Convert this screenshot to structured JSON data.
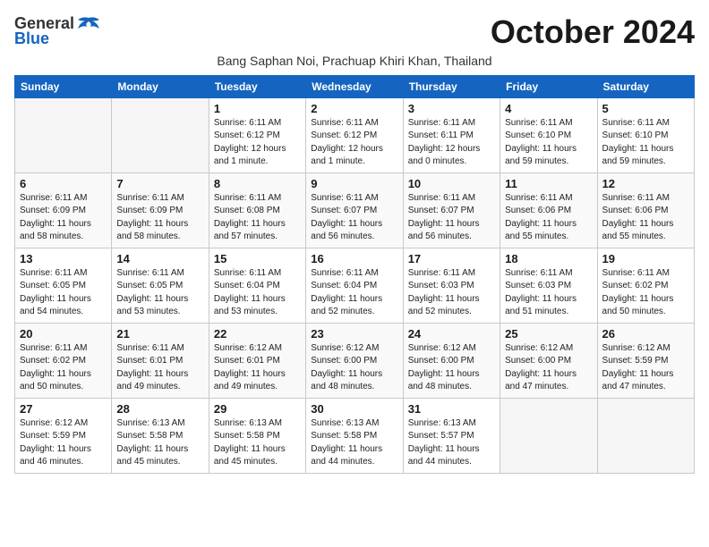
{
  "logo": {
    "general": "General",
    "blue": "Blue"
  },
  "title": "October 2024",
  "subtitle": "Bang Saphan Noi, Prachuap Khiri Khan, Thailand",
  "days_of_week": [
    "Sunday",
    "Monday",
    "Tuesday",
    "Wednesday",
    "Thursday",
    "Friday",
    "Saturday"
  ],
  "weeks": [
    [
      {
        "day": "",
        "empty": true
      },
      {
        "day": "",
        "empty": true
      },
      {
        "day": "1",
        "sunrise": "Sunrise: 6:11 AM",
        "sunset": "Sunset: 6:12 PM",
        "daylight": "Daylight: 12 hours and 1 minute."
      },
      {
        "day": "2",
        "sunrise": "Sunrise: 6:11 AM",
        "sunset": "Sunset: 6:12 PM",
        "daylight": "Daylight: 12 hours and 1 minute."
      },
      {
        "day": "3",
        "sunrise": "Sunrise: 6:11 AM",
        "sunset": "Sunset: 6:11 PM",
        "daylight": "Daylight: 12 hours and 0 minutes."
      },
      {
        "day": "4",
        "sunrise": "Sunrise: 6:11 AM",
        "sunset": "Sunset: 6:10 PM",
        "daylight": "Daylight: 11 hours and 59 minutes."
      },
      {
        "day": "5",
        "sunrise": "Sunrise: 6:11 AM",
        "sunset": "Sunset: 6:10 PM",
        "daylight": "Daylight: 11 hours and 59 minutes."
      }
    ],
    [
      {
        "day": "6",
        "sunrise": "Sunrise: 6:11 AM",
        "sunset": "Sunset: 6:09 PM",
        "daylight": "Daylight: 11 hours and 58 minutes."
      },
      {
        "day": "7",
        "sunrise": "Sunrise: 6:11 AM",
        "sunset": "Sunset: 6:09 PM",
        "daylight": "Daylight: 11 hours and 58 minutes."
      },
      {
        "day": "8",
        "sunrise": "Sunrise: 6:11 AM",
        "sunset": "Sunset: 6:08 PM",
        "daylight": "Daylight: 11 hours and 57 minutes."
      },
      {
        "day": "9",
        "sunrise": "Sunrise: 6:11 AM",
        "sunset": "Sunset: 6:07 PM",
        "daylight": "Daylight: 11 hours and 56 minutes."
      },
      {
        "day": "10",
        "sunrise": "Sunrise: 6:11 AM",
        "sunset": "Sunset: 6:07 PM",
        "daylight": "Daylight: 11 hours and 56 minutes."
      },
      {
        "day": "11",
        "sunrise": "Sunrise: 6:11 AM",
        "sunset": "Sunset: 6:06 PM",
        "daylight": "Daylight: 11 hours and 55 minutes."
      },
      {
        "day": "12",
        "sunrise": "Sunrise: 6:11 AM",
        "sunset": "Sunset: 6:06 PM",
        "daylight": "Daylight: 11 hours and 55 minutes."
      }
    ],
    [
      {
        "day": "13",
        "sunrise": "Sunrise: 6:11 AM",
        "sunset": "Sunset: 6:05 PM",
        "daylight": "Daylight: 11 hours and 54 minutes."
      },
      {
        "day": "14",
        "sunrise": "Sunrise: 6:11 AM",
        "sunset": "Sunset: 6:05 PM",
        "daylight": "Daylight: 11 hours and 53 minutes."
      },
      {
        "day": "15",
        "sunrise": "Sunrise: 6:11 AM",
        "sunset": "Sunset: 6:04 PM",
        "daylight": "Daylight: 11 hours and 53 minutes."
      },
      {
        "day": "16",
        "sunrise": "Sunrise: 6:11 AM",
        "sunset": "Sunset: 6:04 PM",
        "daylight": "Daylight: 11 hours and 52 minutes."
      },
      {
        "day": "17",
        "sunrise": "Sunrise: 6:11 AM",
        "sunset": "Sunset: 6:03 PM",
        "daylight": "Daylight: 11 hours and 52 minutes."
      },
      {
        "day": "18",
        "sunrise": "Sunrise: 6:11 AM",
        "sunset": "Sunset: 6:03 PM",
        "daylight": "Daylight: 11 hours and 51 minutes."
      },
      {
        "day": "19",
        "sunrise": "Sunrise: 6:11 AM",
        "sunset": "Sunset: 6:02 PM",
        "daylight": "Daylight: 11 hours and 50 minutes."
      }
    ],
    [
      {
        "day": "20",
        "sunrise": "Sunrise: 6:11 AM",
        "sunset": "Sunset: 6:02 PM",
        "daylight": "Daylight: 11 hours and 50 minutes."
      },
      {
        "day": "21",
        "sunrise": "Sunrise: 6:11 AM",
        "sunset": "Sunset: 6:01 PM",
        "daylight": "Daylight: 11 hours and 49 minutes."
      },
      {
        "day": "22",
        "sunrise": "Sunrise: 6:12 AM",
        "sunset": "Sunset: 6:01 PM",
        "daylight": "Daylight: 11 hours and 49 minutes."
      },
      {
        "day": "23",
        "sunrise": "Sunrise: 6:12 AM",
        "sunset": "Sunset: 6:00 PM",
        "daylight": "Daylight: 11 hours and 48 minutes."
      },
      {
        "day": "24",
        "sunrise": "Sunrise: 6:12 AM",
        "sunset": "Sunset: 6:00 PM",
        "daylight": "Daylight: 11 hours and 48 minutes."
      },
      {
        "day": "25",
        "sunrise": "Sunrise: 6:12 AM",
        "sunset": "Sunset: 6:00 PM",
        "daylight": "Daylight: 11 hours and 47 minutes."
      },
      {
        "day": "26",
        "sunrise": "Sunrise: 6:12 AM",
        "sunset": "Sunset: 5:59 PM",
        "daylight": "Daylight: 11 hours and 47 minutes."
      }
    ],
    [
      {
        "day": "27",
        "sunrise": "Sunrise: 6:12 AM",
        "sunset": "Sunset: 5:59 PM",
        "daylight": "Daylight: 11 hours and 46 minutes."
      },
      {
        "day": "28",
        "sunrise": "Sunrise: 6:13 AM",
        "sunset": "Sunset: 5:58 PM",
        "daylight": "Daylight: 11 hours and 45 minutes."
      },
      {
        "day": "29",
        "sunrise": "Sunrise: 6:13 AM",
        "sunset": "Sunset: 5:58 PM",
        "daylight": "Daylight: 11 hours and 45 minutes."
      },
      {
        "day": "30",
        "sunrise": "Sunrise: 6:13 AM",
        "sunset": "Sunset: 5:58 PM",
        "daylight": "Daylight: 11 hours and 44 minutes."
      },
      {
        "day": "31",
        "sunrise": "Sunrise: 6:13 AM",
        "sunset": "Sunset: 5:57 PM",
        "daylight": "Daylight: 11 hours and 44 minutes."
      },
      {
        "day": "",
        "empty": true
      },
      {
        "day": "",
        "empty": true
      }
    ]
  ]
}
